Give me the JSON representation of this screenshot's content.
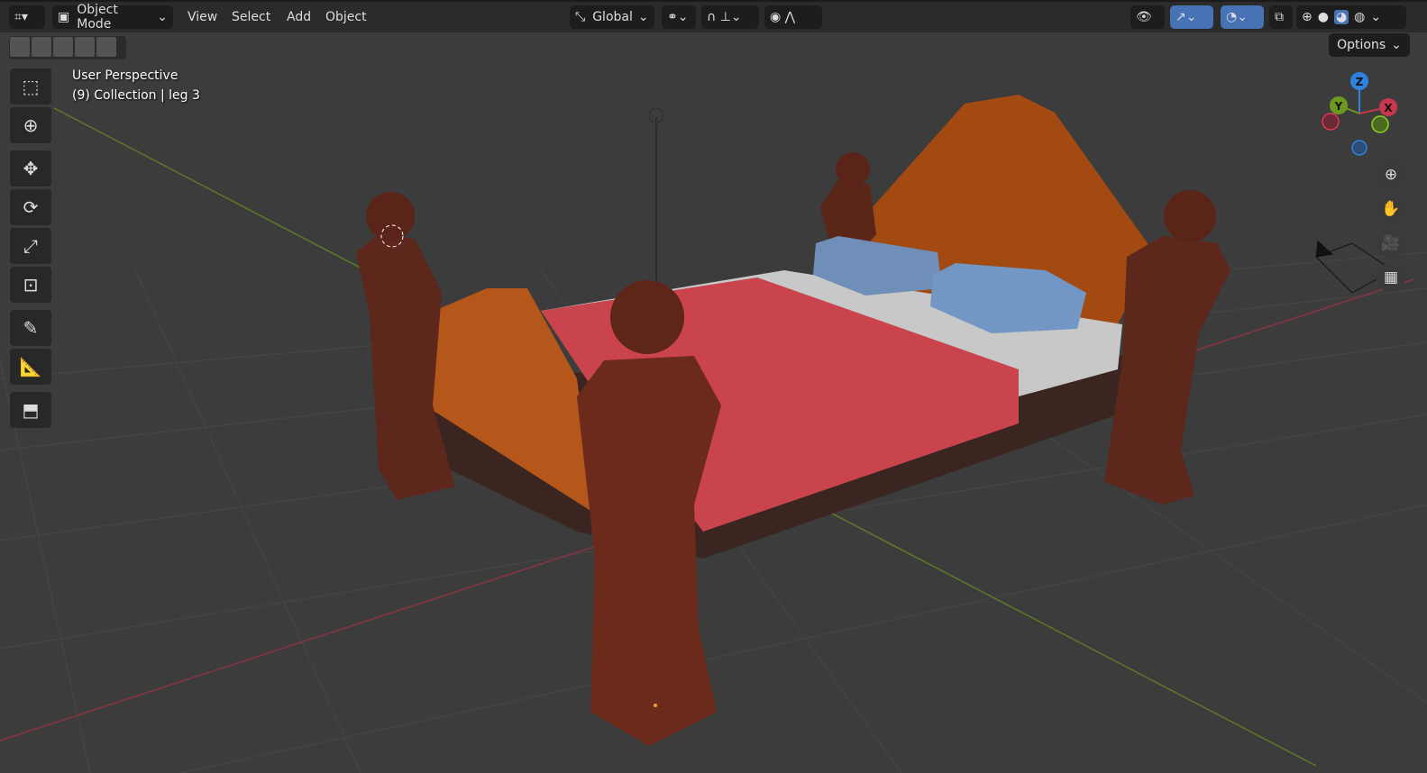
{
  "header": {
    "editor_type_icon": "3d-viewport-icon",
    "mode": "Object Mode",
    "menus": [
      "View",
      "Select",
      "Add",
      "Object"
    ],
    "orientation": "Global",
    "options": "Options"
  },
  "viewport": {
    "perspective": "User Perspective",
    "collection": "(9) Collection | leg 3"
  },
  "gizmo": {
    "z": "Z",
    "y": "Y",
    "x": "X"
  },
  "colors": {
    "accent": "#4772b3",
    "axis_x": "#c9384a",
    "axis_y": "#6b9a1f",
    "axis_z": "#2f83e0"
  }
}
